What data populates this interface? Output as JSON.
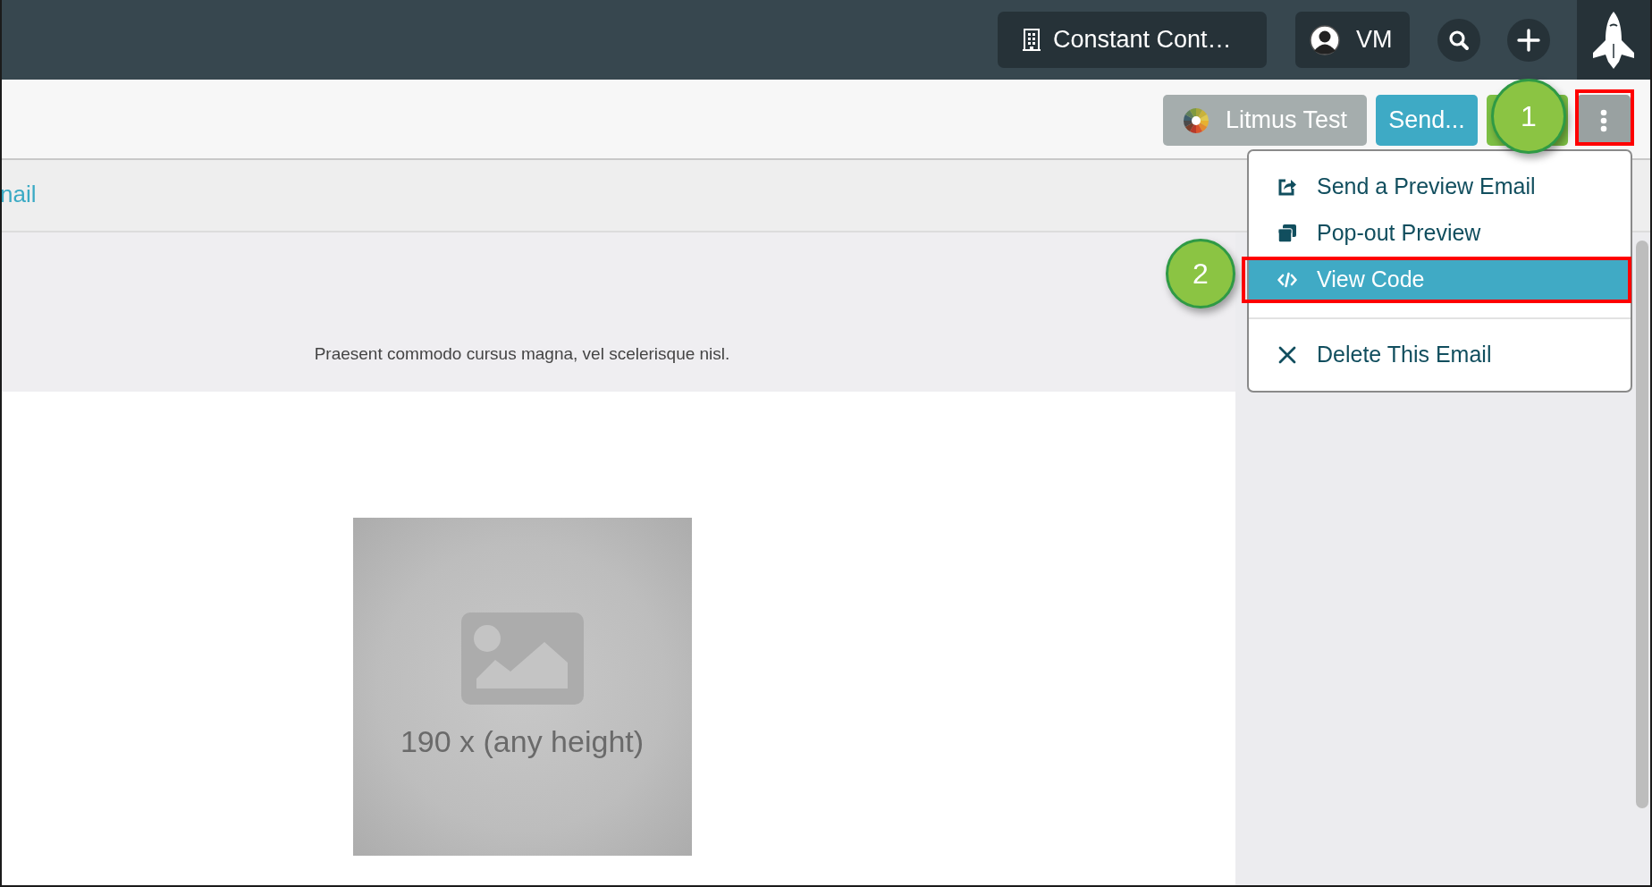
{
  "top_bar": {
    "org_button": "Constant Cont…",
    "user_button": "VM"
  },
  "toolbar": {
    "buttons": [
      {
        "kind": "litmus",
        "label": "Litmus Test"
      },
      {
        "kind": "send",
        "label": "Send..."
      },
      {
        "kind": "green"
      },
      {
        "kind": "more"
      }
    ]
  },
  "tab_row": {
    "link": "nail"
  },
  "email": {
    "text": "Praesent commodo cursus magna, vel scelerisque nisl.",
    "image_placeholder": "190 x (any height)"
  },
  "menu": {
    "items": [
      {
        "kind": "share",
        "label": "Send a Preview Email",
        "selected": false
      },
      {
        "kind": "popout",
        "label": "Pop-out Preview",
        "selected": false
      },
      {
        "kind": "code",
        "label": "View Code",
        "selected": true
      },
      {
        "kind": "separator"
      },
      {
        "kind": "delete",
        "label": "Delete This Email",
        "selected": false
      }
    ]
  },
  "callouts": [
    {
      "label": "1"
    },
    {
      "label": "2"
    }
  ]
}
